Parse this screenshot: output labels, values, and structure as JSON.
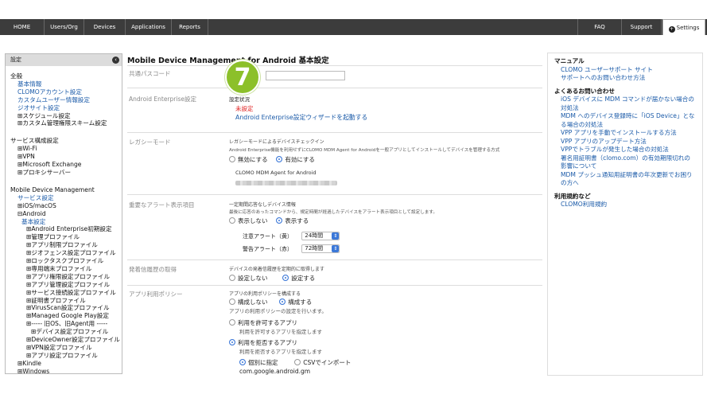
{
  "nav": {
    "tabs": [
      "HOME",
      "Users/Org",
      "Devices",
      "Applications",
      "Reports"
    ],
    "right": [
      "FAQ",
      "Support"
    ],
    "settings": "Settings"
  },
  "sidebar": {
    "header": "設定",
    "sections": [
      {
        "title": "全般",
        "items": [
          {
            "t": "基本情報",
            "k": "link"
          },
          {
            "t": "CLOMOアカウント設定",
            "k": "link"
          },
          {
            "t": "カスタムユーザー情報設定",
            "k": "link"
          },
          {
            "t": "ジオサイト設定",
            "k": "link"
          },
          {
            "t": "スケジュール設定",
            "k": "plus"
          },
          {
            "t": "カスタム管理権限スキーム設定",
            "k": "plus"
          }
        ]
      },
      {
        "title": "サービス構成設定",
        "items": [
          {
            "t": "Wi-Fi",
            "k": "plus"
          },
          {
            "t": "VPN",
            "k": "plus"
          },
          {
            "t": "Microsoft Exchange",
            "k": "plus"
          },
          {
            "t": "プロキシサーバー",
            "k": "plus"
          }
        ]
      },
      {
        "title": "Mobile Device Management",
        "items": [
          {
            "t": "サービス設定",
            "k": "link"
          },
          {
            "t": "iOS/macOS",
            "k": "plus"
          },
          {
            "t": "Android",
            "k": "minus"
          },
          {
            "t": "基本設定",
            "k": "sub"
          },
          {
            "t": "Android Enterprise初期設定",
            "k": "plus2"
          },
          {
            "t": "管理プロファイル",
            "k": "plus2"
          },
          {
            "t": "アプリ制限プロファイル",
            "k": "plus2"
          },
          {
            "t": "ジオフェンス設定プロファイル",
            "k": "plus2"
          },
          {
            "t": "ロックタスクプロファイル",
            "k": "plus2"
          },
          {
            "t": "専用端末プロファイル",
            "k": "plus2"
          },
          {
            "t": "アプリ権限設定プロファイル",
            "k": "plus2"
          },
          {
            "t": "アプリ管理設定プロファイル",
            "k": "plus2"
          },
          {
            "t": "サービス接続設定プロファイル",
            "k": "plus2"
          },
          {
            "t": "証明書プロファイル",
            "k": "plus2"
          },
          {
            "t": "VirusScan設定プロファイル",
            "k": "plus2"
          },
          {
            "t": "Managed Google Play設定",
            "k": "plus2"
          },
          {
            "t": "----- 旧OS、旧Agent用 -----",
            "k": "plus2"
          },
          {
            "t": "デバイス設定プロファイル",
            "k": "plus3"
          },
          {
            "t": "DeviceOwner設定プロファイル",
            "k": "plus2"
          },
          {
            "t": "VPN設定プロファイル",
            "k": "plus2"
          },
          {
            "t": "アプリ設定プロファイル",
            "k": "plus2"
          },
          {
            "t": "Kindle",
            "k": "plus"
          },
          {
            "t": "Windows",
            "k": "plus"
          }
        ]
      }
    ]
  },
  "main": {
    "title": "Mobile Device Management for Android 基本設定",
    "rows": {
      "passcode": {
        "label": "共通パスコード"
      },
      "enterprise": {
        "label": "Android Enterprise設定",
        "status_label": "設定状況",
        "status_value": "未設定",
        "wizard_link": "Android Enterprise設定ウィザードを起動する"
      },
      "legacy": {
        "label": "レガシーモード",
        "heading": "レガシーモードによるデバイスチェックイン",
        "desc": "Android Enterprise機能を利用せずにCLOMO MDM Agent for Androidを一般アプリとしてインストールしてデバイスを管理する方式",
        "opt_off": "無効にする",
        "opt_on": "有効にする",
        "agent_label": "CLOMO MDM Agent for Android"
      },
      "alert": {
        "label": "重要なアラート表示項目",
        "heading": "一定期間応答なしデバイス情報",
        "desc": "最後に応答のあったコマンドから、規定時間が経過したデバイスをアラート表示項目として設定します。",
        "opt_hide": "表示しない",
        "opt_show": "表示する",
        "warn_label": "注意アラート（黄）",
        "warn_value": "24時間",
        "alarm_label": "警告アラート（赤）",
        "alarm_value": "72時間"
      },
      "history": {
        "label": "発着信履歴の取得",
        "heading": "デバイスの発着信履歴を定期的に取得します",
        "opt_off": "設定しない",
        "opt_on": "設定する"
      },
      "policy": {
        "label": "アプリ利用ポリシー",
        "heading": "アプリの利用ポリシーを構成する",
        "opt_off": "構成しない",
        "opt_on": "構成する",
        "desc": "アプリの利用ポリシーの設定を行います。",
        "allow_title": "利用を許可するアプリ",
        "allow_desc": "利用を許可するアプリを指定します",
        "deny_title": "利用を拒否するアプリ",
        "deny_desc": "利用を拒否するアプリを指定します",
        "individual": "個別に指定",
        "csv": "CSVでインポート",
        "pkg": "com.google.android.gm"
      }
    }
  },
  "badge": {
    "number": "7",
    "color": "#8cc02a"
  },
  "rightpanel": {
    "manual_title": "マニュアル",
    "manual_links": [
      "CLOMO ユーザーサポート サイト",
      "サポートへのお問い合わせ方法"
    ],
    "faq_title": "よくあるお問い合わせ",
    "faq_links": [
      "iOS デバイスに MDM コマンドが届かない場合の対処法",
      "MDM へのデバイス登録時に「iOS Device」となる場合の対処法",
      "VPP アプリを手動でインストールする方法",
      "VPP アプリのアップデート方法",
      "VPPでトラブルが発生した場合の対処法",
      "署名用証明書（clomo.com）の有効期限切れの影響について",
      "MDM プッシュ通知用証明書の年次更新でお困りの方へ"
    ],
    "terms_title": "利用規約など",
    "terms_links": [
      "CLOMO利用規約"
    ]
  }
}
